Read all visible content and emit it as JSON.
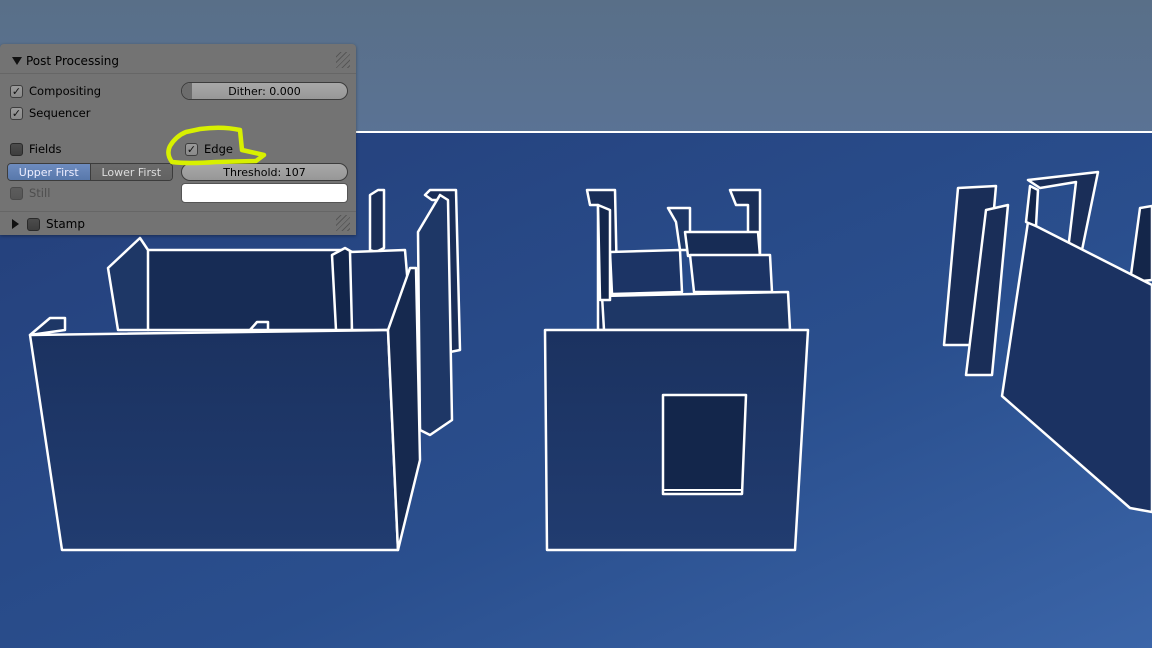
{
  "panel": {
    "section_title": "Post Processing",
    "compositing": {
      "label": "Compositing",
      "checked": true
    },
    "sequencer": {
      "label": "Sequencer",
      "checked": true
    },
    "dither": {
      "label": "Dither: 0.000",
      "value": 0.0
    },
    "fields": {
      "label": "Fields",
      "checked": false
    },
    "edge": {
      "label": "Edge",
      "checked": true
    },
    "field_order": {
      "options": [
        "Upper First",
        "Lower First"
      ],
      "selected": "Upper First"
    },
    "threshold": {
      "label": "Threshold: 107",
      "value": 107
    },
    "still": {
      "label": "Still",
      "checked": false,
      "enabled": false
    },
    "edge_color_value": "",
    "stamp": {
      "label": "Stamp",
      "checked": false
    }
  },
  "icons": {
    "expanded": "triangle-down-icon",
    "collapsed": "triangle-right-icon",
    "check": "checkmark-icon",
    "annotation": "highlight-scribble-icon"
  },
  "colors": {
    "sky": "#58718f",
    "ground": "#2a4f8e",
    "wall_face": "#1e3766",
    "wall_dark": "#14264a",
    "edge_line": "#ffffff",
    "panel_bg": "#737373",
    "highlight": "#d8f000"
  }
}
